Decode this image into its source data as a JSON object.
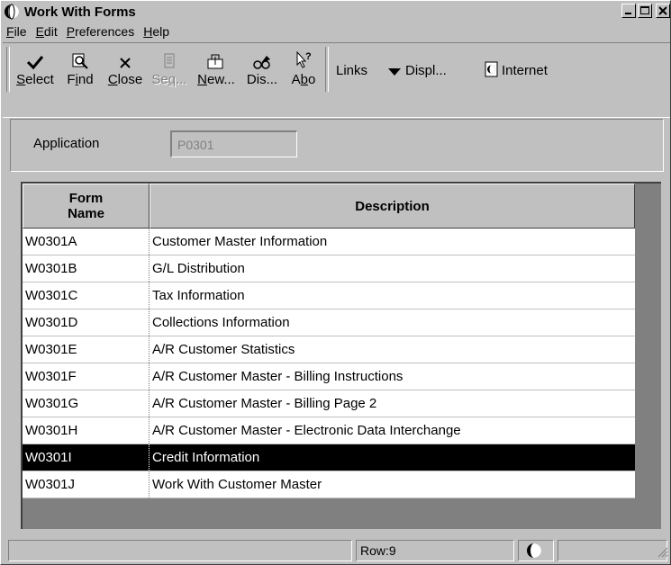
{
  "window": {
    "title": "Work With Forms"
  },
  "menu": [
    {
      "mnemonic": "F",
      "rest": "ile"
    },
    {
      "mnemonic": "E",
      "rest": "dit"
    },
    {
      "mnemonic": "P",
      "rest": "references"
    },
    {
      "mnemonic": "H",
      "rest": "elp"
    }
  ],
  "toolbar": {
    "select": {
      "pre": "",
      "mn": "S",
      "post": "elect"
    },
    "find": {
      "pre": "F",
      "mn": "i",
      "post": "nd"
    },
    "close": {
      "pre": "",
      "mn": "C",
      "post": "lose"
    },
    "seq": {
      "pre": "Se",
      "mn": "q",
      "post": "..."
    },
    "new": {
      "pre": "",
      "mn": "N",
      "post": "ew..."
    },
    "dis": {
      "label": "Dis..."
    },
    "abo": {
      "pre": "A",
      "mn": "b",
      "post": "o"
    },
    "links": "Links",
    "displ": "Displ...",
    "internet": "Internet"
  },
  "header": {
    "application_label": "Application",
    "application_value": "P0301"
  },
  "grid": {
    "columns": [
      "Form\nName",
      "Description"
    ],
    "rows": [
      {
        "form": "W0301A",
        "desc": "Customer Master Information"
      },
      {
        "form": "W0301B",
        "desc": "G/L Distribution"
      },
      {
        "form": "W0301C",
        "desc": "Tax Information"
      },
      {
        "form": "W0301D",
        "desc": "Collections Information"
      },
      {
        "form": "W0301E",
        "desc": "A/R Customer Statistics"
      },
      {
        "form": "W0301F",
        "desc": "A/R Customer Master - Billing Instructions"
      },
      {
        "form": "W0301G",
        "desc": "A/R Customer Master - Billing  Page 2"
      },
      {
        "form": "W0301H",
        "desc": "A/R Customer Master - Electronic Data Interchange"
      },
      {
        "form": "W0301I",
        "desc": "Credit Information"
      },
      {
        "form": "W0301J",
        "desc": "Work With Customer Master"
      }
    ],
    "selected_index": 8
  },
  "status": {
    "row": "Row:9"
  }
}
